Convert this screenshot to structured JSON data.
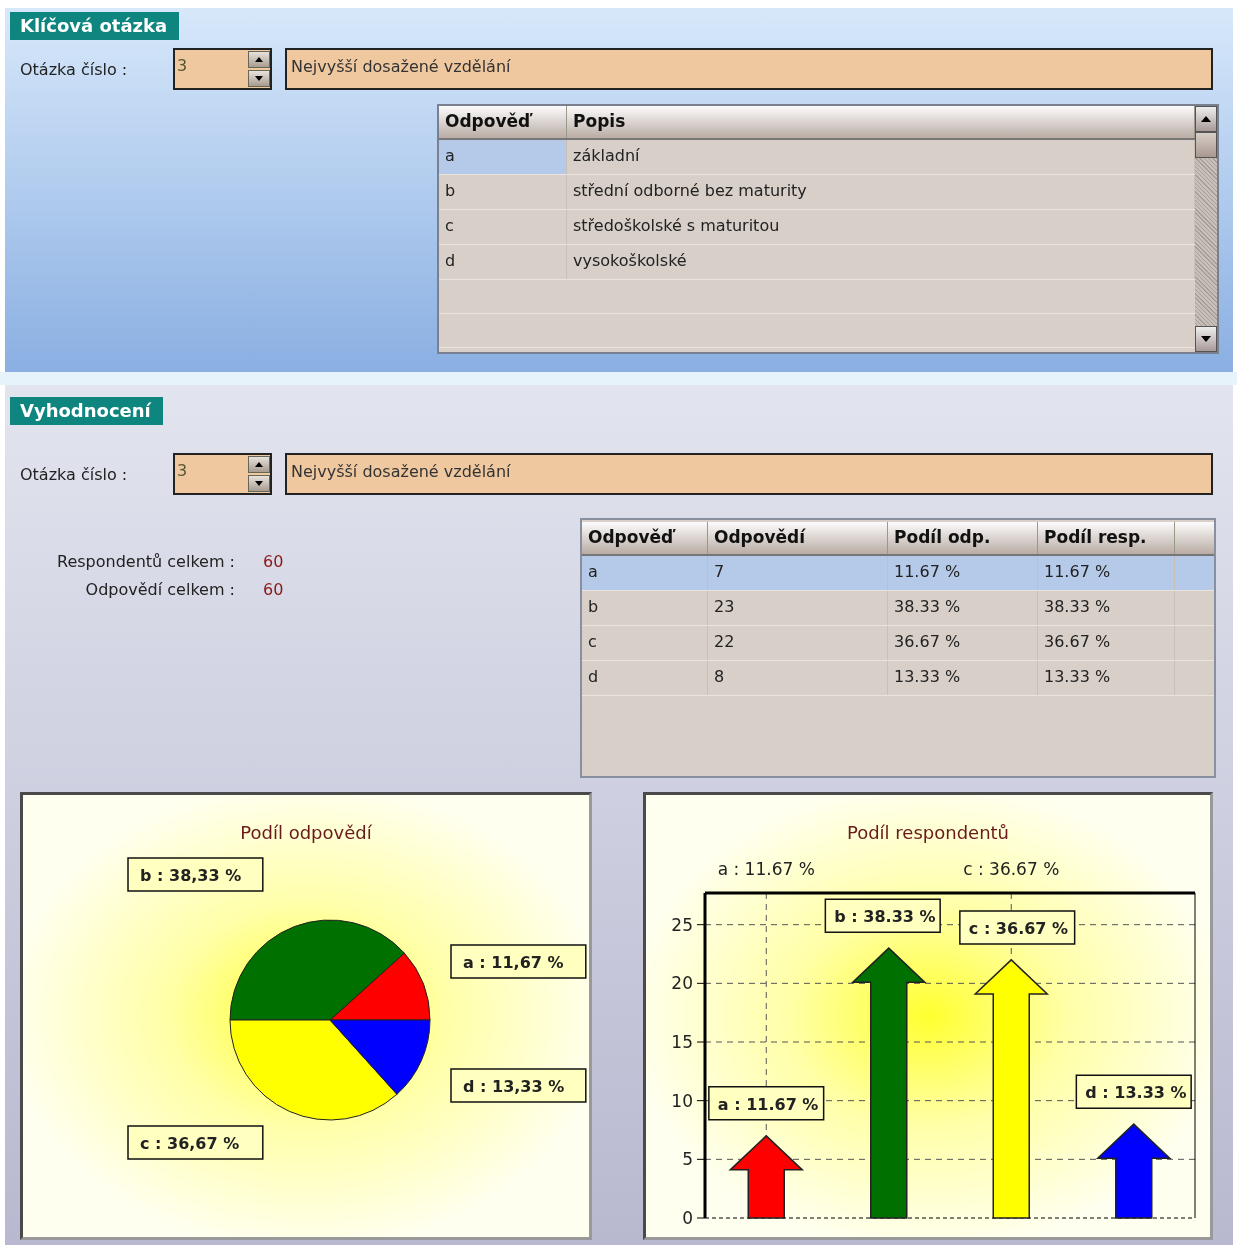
{
  "key_question": {
    "title": "Klíčová otázka",
    "question_label": "Otázka číslo :",
    "question_number": "3",
    "question_text": "Nejvyšší dosažené vzdělání",
    "table": {
      "columns": [
        "Odpověď",
        "Popis"
      ],
      "rows": [
        {
          "cells": [
            "a",
            "základní"
          ],
          "selected": true
        },
        {
          "cells": [
            "b",
            "střední odborné bez maturity"
          ],
          "selected": false
        },
        {
          "cells": [
            "c",
            "středoškolské s maturitou"
          ],
          "selected": false
        },
        {
          "cells": [
            "d",
            "vysokoškolské"
          ],
          "selected": false
        }
      ]
    }
  },
  "evaluation": {
    "title": "Vyhodnocení",
    "question_label": "Otázka číslo :",
    "question_number": "3",
    "question_text": "Nejvyšší dosažené vzdělání",
    "stats": [
      {
        "label": "Respondentů celkem :",
        "value": "60"
      },
      {
        "label": "Odpovědí celkem :",
        "value": "60"
      }
    ],
    "table": {
      "columns": [
        "Odpověď",
        "Odpovědí",
        "Podíl odp.",
        "Podíl resp."
      ],
      "rows": [
        {
          "cells": [
            "a",
            "7",
            "11.67 %",
            "11.67 %"
          ],
          "selected": true
        },
        {
          "cells": [
            "b",
            "23",
            "38.33 %",
            "38.33 %"
          ],
          "selected": false
        },
        {
          "cells": [
            "c",
            "22",
            "36.67 %",
            "36.67 %"
          ],
          "selected": false
        },
        {
          "cells": [
            "d",
            "8",
            "13.33 %",
            "13.33 %"
          ],
          "selected": false
        }
      ]
    },
    "pie_chart": {
      "chart_data": {
        "type": "pie",
        "title": "Podíl odpovědí",
        "series": [
          {
            "values": [
              11.67,
              38.33,
              36.67,
              13.33
            ],
            "colors": [
              "#ff0000",
              "#007000",
              "#ffff00",
              "#0000ff"
            ]
          }
        ],
        "value_labels": [
          "a : 11,67 %",
          "b : 38,33 %",
          "c : 36,67 %",
          "d : 13,33 %"
        ]
      }
    },
    "arrow_chart": {
      "chart_data": {
        "type": "bar",
        "title": "Podíl respondentů",
        "categories": [
          "a : 11.67 %",
          null,
          "c : 36.67 %",
          null
        ],
        "series": [
          {
            "values": [
              7,
              23,
              22,
              8
            ],
            "colors": [
              "#ff0000",
              "#007000",
              "#ffff00",
              "#0000ff"
            ]
          }
        ],
        "ylim": [
          0,
          27.7
        ],
        "yticks": [
          0,
          5,
          10,
          15,
          20,
          25
        ],
        "grid": true,
        "value_labels": [
          "a : 11.67 %",
          "b : 38.33 %",
          "c : 36.67 %",
          "d : 13.33 %"
        ]
      }
    }
  }
}
